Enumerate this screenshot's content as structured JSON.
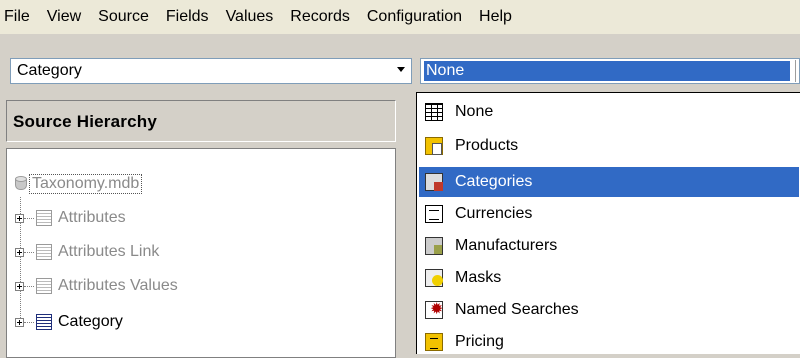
{
  "menu": [
    "File",
    "View",
    "Source",
    "Fields",
    "Values",
    "Records",
    "Configuration",
    "Help"
  ],
  "toolbar": {
    "left_combo_value": "Category",
    "right_combo_value": "None"
  },
  "left_panel": {
    "title": "Source Hierarchy",
    "root": "Taxonomy.mdb",
    "items": [
      "Attributes",
      "Attributes Link",
      "Attributes Values",
      "Category"
    ]
  },
  "dropdown": {
    "selected": "Categories",
    "items": [
      {
        "label": "None",
        "icon": "grid-table-icon"
      },
      {
        "label": "Products",
        "icon": "products-icon"
      },
      {
        "label": "Categories",
        "icon": "categories-icon"
      },
      {
        "label": "Currencies",
        "icon": "currencies-icon"
      },
      {
        "label": "Manufacturers",
        "icon": "manufacturers-icon"
      },
      {
        "label": "Masks",
        "icon": "masks-icon"
      },
      {
        "label": "Named Searches",
        "icon": "named-searches-icon"
      },
      {
        "label": "Pricing",
        "icon": "pricing-icon"
      }
    ]
  }
}
